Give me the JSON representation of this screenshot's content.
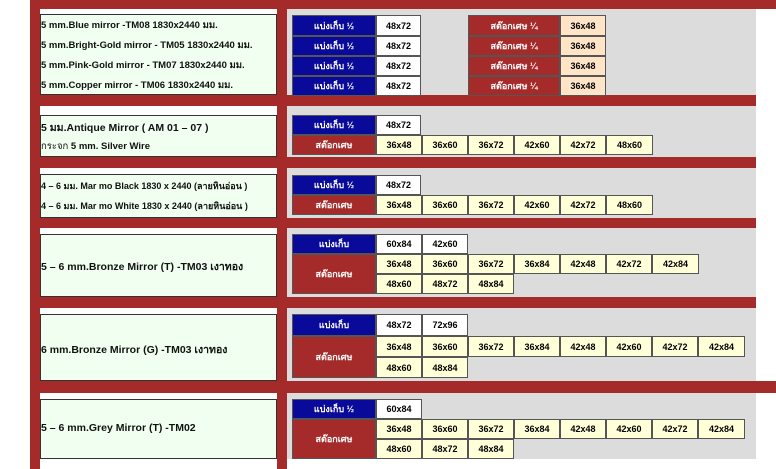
{
  "labels": {
    "split": "แบ่งเก็บ",
    "split_half": "แบ่งเก็บ ½",
    "stock": "สต๊อกเศษ",
    "stock_quarter": "สต๊อกเศษ ¼"
  },
  "s1": {
    "rows": [
      {
        "name": "5 mm.Blue mirror -TM08  1830x2440 มม.",
        "size": "48x72",
        "stock_size": "36x48"
      },
      {
        "name": "5 mm.Bright-Gold mirror - TM05  1830x2440 มม.",
        "size": "48x72",
        "stock_size": "36x48"
      },
      {
        "name": "5 mm.Pink-Gold mirror - TM07  1830x2440 มม.",
        "size": "48x72",
        "stock_size": "36x48"
      },
      {
        "name": "5 mm.Copper mirror - TM06  1830x2440 มม.",
        "size": "48x72",
        "stock_size": "36x48"
      }
    ]
  },
  "s2": {
    "line1": "5 มม.Antique Mirror ( AM 01 – 07 )",
    "line2_prefix": "กระจก",
    "line2_rest": " 5 mm. Silver Wire",
    "split_sizes": [
      "48x72"
    ],
    "stock_sizes": [
      "36x48",
      "36x60",
      "36x72",
      "42x60",
      "42x72",
      "48x60"
    ]
  },
  "s3": {
    "line1": "4 – 6 มม. Mar mo Black 1830 x 2440 (ลายหินอ่อน )",
    "line2": "4 – 6 มม. Mar mo White 1830 x 2440 (ลายหินอ่อน )",
    "split_sizes": [
      "48x72"
    ],
    "stock_sizes": [
      "36x48",
      "36x60",
      "36x72",
      "42x60",
      "42x72",
      "48x60"
    ]
  },
  "s4": {
    "name": "5 – 6  mm.Bronze Mirror (T) -TM03  เงาทอง",
    "split_sizes": [
      "60x84",
      "42x60"
    ],
    "stock_row1": [
      "36x48",
      "36x60",
      "36x72",
      "36x84",
      "42x48",
      "42x72",
      "42x84"
    ],
    "stock_row2": [
      "48x60",
      "48x72",
      "48x84"
    ]
  },
  "s5": {
    "name": "6 mm.Bronze Mirror (G) -TM03 เงาทอง",
    "split_sizes": [
      "48x72",
      "72x96"
    ],
    "stock_row1": [
      "36x48",
      "36x60",
      "36x72",
      "36x84",
      "42x48",
      "42x60",
      "42x72",
      "42x84"
    ],
    "stock_row2": [
      "48x60",
      "48x84"
    ]
  },
  "s6": {
    "name": "5 – 6  mm.Grey Mirror (T)  -TM02",
    "split_sizes": [
      "60x84"
    ],
    "stock_row1": [
      "36x48",
      "36x60",
      "36x72",
      "36x84",
      "42x48",
      "42x60",
      "42x72",
      "42x84"
    ],
    "stock_row2": [
      "48x60",
      "48x72",
      "48x84"
    ]
  },
  "colors": {
    "maroon": "#a52a2a",
    "blue": "#0a0a9a",
    "cream": "#ffffd8",
    "peach": "#ffe4c8",
    "panel_green": "#f0fff0",
    "panel_gray": "#dcdcdc"
  }
}
